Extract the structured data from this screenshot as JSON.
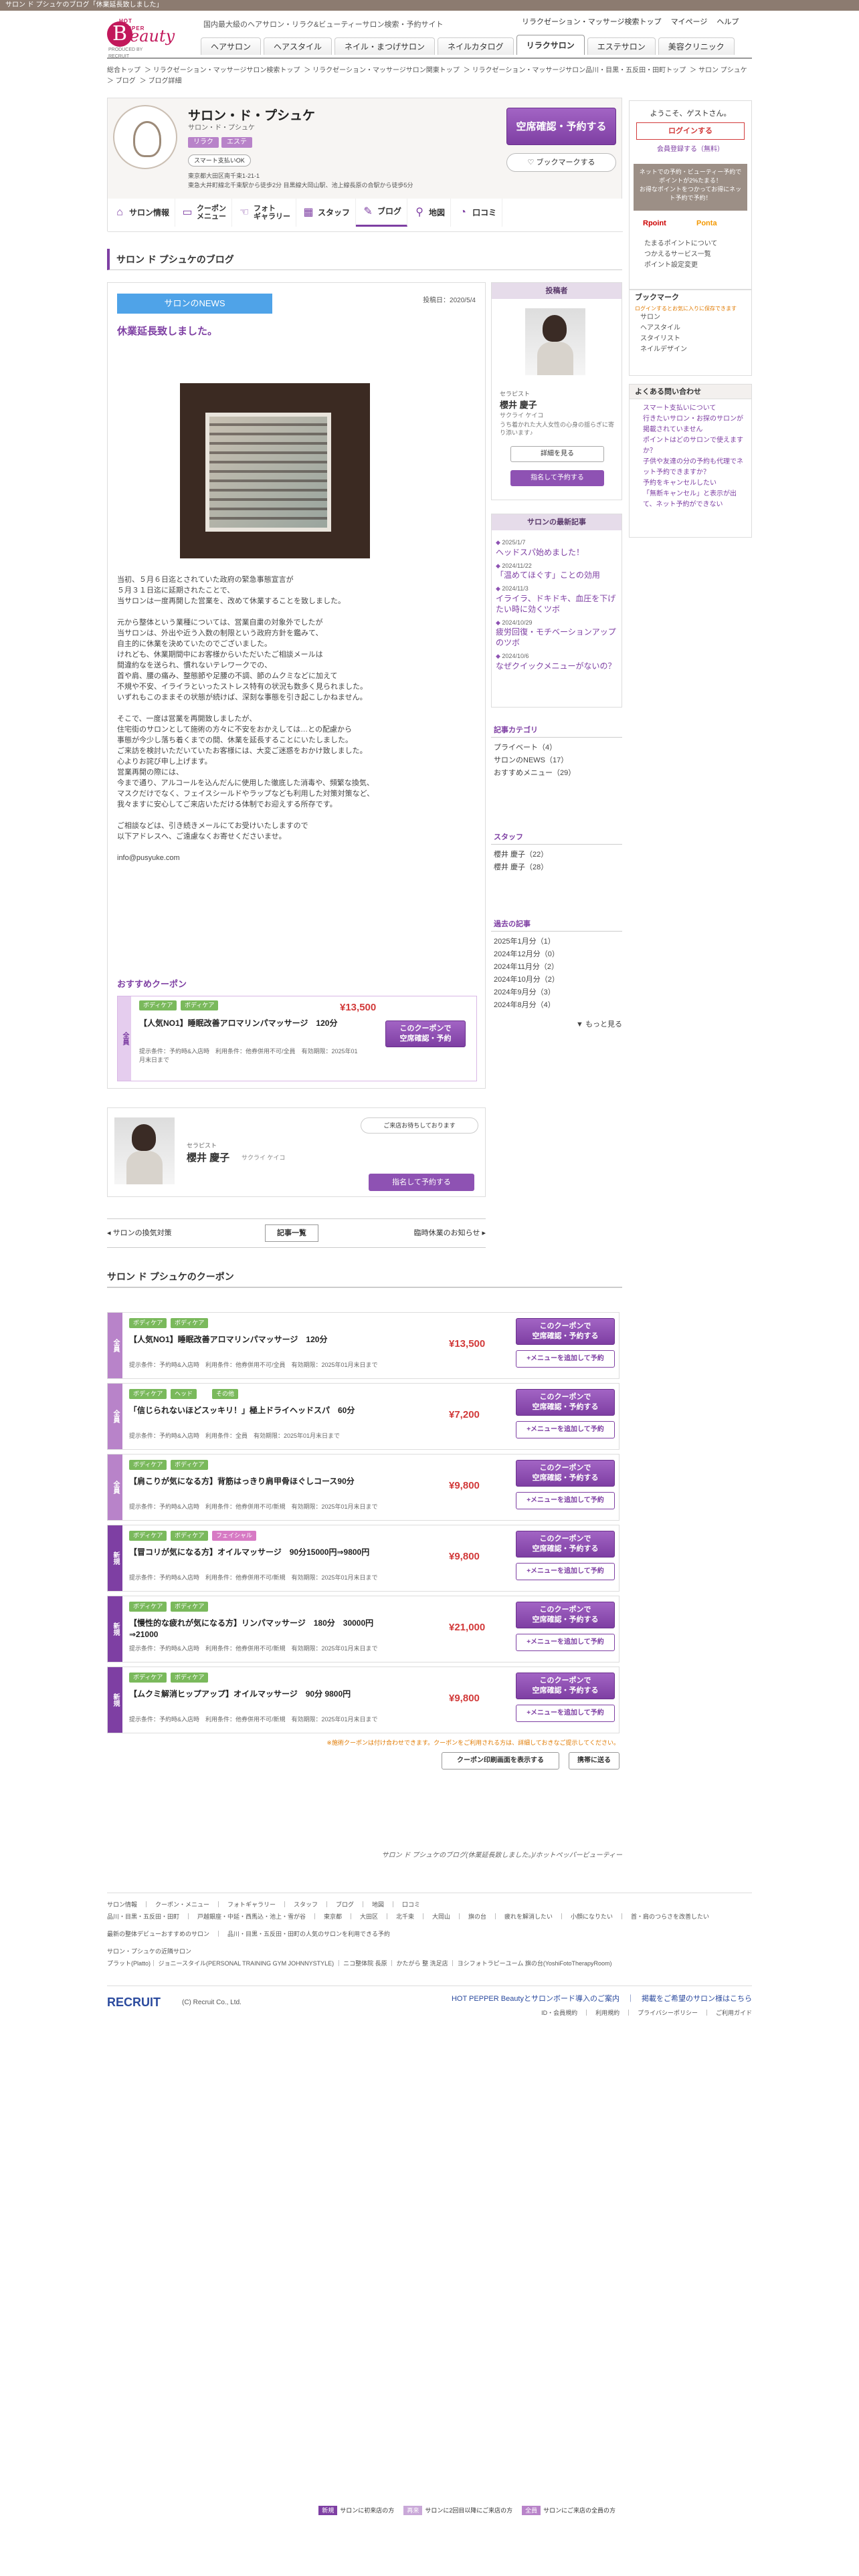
{
  "top_strip": "サロン ド プシュケのブログ「休業延長致しました」",
  "header": {
    "logo_hp": "HOT PEPPER",
    "logo_b": "B",
    "logo_eauty": "eauty",
    "logo_by": "PRODUCED BY RECRUIT",
    "tagline": "国内最大級のヘアサロン・リラク&ビューティーサロン検索・予約サイト",
    "links": [
      "リラクゼーション・マッサージ検索トップ",
      "マイページ",
      "ヘルプ"
    ],
    "nav": [
      "ヘアサロン",
      "ヘアスタイル",
      "ネイル・まつげサロン",
      "ネイルカタログ",
      "リラクサロン",
      "エステサロン",
      "美容クリニック"
    ]
  },
  "breadcrumb": [
    "総合トップ",
    "リラクゼーション・マッサージサロン検索トップ",
    "リラクゼーション・マッサージサロン関東トップ",
    "リラクゼーション・マッサージサロン品川・目黒・五反田・田町トップ",
    "サロン プシュケ",
    "ブログ",
    "ブログ詳細"
  ],
  "shop": {
    "name": "サロン・ド・プシュケ",
    "kana": "サロン・ド・プシュケ",
    "tags": [
      "リラク",
      "エステ"
    ],
    "smartpay": "スマート支払いOK",
    "addr1": "東京都大田区南千束1-21-1",
    "addr2": "東急大井町線北千束駅から徒歩2分 目黒線大岡山駅、池上線長原の合駅から徒歩5分",
    "reserve_btn": "空席確認・予約する",
    "bookmark_btn": "ブックマークする",
    "tabs": [
      "サロン情報",
      "クーポン\nメニュー",
      "フォト\nギャラリー",
      "スタッフ",
      "ブログ",
      "地図",
      "口コミ"
    ]
  },
  "blog": {
    "heading": "サロン ド プシュケのブログ",
    "category": "サロンのNEWS",
    "date": "投稿日：2020/5/4",
    "title": "休業延長致しました。",
    "body": [
      "当初、５月６日迄とされていた政府の緊急事態宣言が",
      "５月３１日迄に延期されたことで、",
      "当サロンは一度再開した営業を、改めて休業することを致しました。",
      "",
      "元から整体という業種については、営業自粛の対象外でしたが",
      "当サロンは、外出や近う入数の制限という政府方針を鑑みて、",
      "自主的に休業を決めていたのでございました。",
      "けれども、休業期間中にお客様からいただいたご相談メールは",
      "間違約なを送られ、慣れないテレワークでの、",
      "首や肩、腰の痛み、整態節や足腰の不調、節のムクミなどに加えて",
      "不規や不安、イライラといったストレス特有の状況も数多く見られました。",
      "いずれもこのままその状態が続けば、深刻な事態を引き起こしかねません。",
      "",
      "そこで、一度は営業を再開致しましたが、",
      "住宅街のサロンとして施術の方々に不安をおかえしては…との配慮から",
      "事態が今少し落ち着くまでの間、休業を延長することにいたしました。",
      "ご来訪を検討いただいていたお客様には、大変ご迷惑をおかけ致しました。",
      "心よりお詫び申し上げます。",
      "営業再開の際には、",
      "今まで通り、アルコールを込んだんに使用した徹底した消毒や、頻繁な換気、",
      "マスクだけでなく、フェイスシールドやラップなども利用した対策対策など、",
      "我々ますに安心してご来店いただける体制でお迎えする所存です。",
      "",
      "ご相談などは、引き続きメールにてお受けいたしますので",
      "以下アドレスへ、ご遠慮なくお寄せくださいませ。",
      "",
      "info@pusyuke.com"
    ],
    "rec_title": "おすすめクーポン",
    "rec_coupon": {
      "band": "全員",
      "tags": [
        "ボディケア",
        "ボディケア"
      ],
      "price": "¥13,500",
      "name": "【人気NO1】睡眠改善アロマリンパマッサージ　120分",
      "meta": "提示条件：予約時&入店時　利用条件：他券併用不可/全員　有効期限：2025年01月末日まで",
      "btn": "このクーポンで\n空席確認・予約"
    }
  },
  "staff_box": {
    "bubble": "ご来店お待ちしております",
    "role": "セラピスト",
    "name": "櫻井 慶子",
    "kana": "サクライ ケイコ",
    "btn": "指名して予約する"
  },
  "pager": {
    "prev": "サロンの換気対策",
    "list": "記事一覧",
    "next": "臨時休業のお知らせ"
  },
  "poster": {
    "head": "投稿者",
    "role": "セラピスト",
    "name": "櫻井 慶子",
    "kana": "サクライ ケイコ",
    "desc": "うち着かれた大人女性の心身の揺らぎに寄り添います♪",
    "detail_btn": "詳細を見る",
    "nominate_btn": "指名して予約する"
  },
  "recent": {
    "head": "サロンの最新記事",
    "items": [
      {
        "date": "2025/1/7",
        "title": "ヘッドスパ始めました！"
      },
      {
        "date": "2024/11/22",
        "title": "「温めてほぐす」ことの効用"
      },
      {
        "date": "2024/11/3",
        "title": "イライラ、ドキドキ、血圧を下げたい時に効くツボ"
      },
      {
        "date": "2024/10/29",
        "title": "疲労回復・モチベーションアップのツボ"
      },
      {
        "date": "2024/10/6",
        "title": "なぜクイックメニューがないの？"
      }
    ]
  },
  "categories": {
    "head": "記事カテゴリ",
    "items": [
      "プライベート（4）",
      "サロンのNEWS（17）",
      "おすすめメニュー（29）"
    ]
  },
  "staff": {
    "head": "スタッフ",
    "items": [
      "櫻井 慶子（22）",
      "櫻井 慶子（28）"
    ]
  },
  "archive": {
    "head": "過去の記事",
    "items": [
      "2025年1月分（1）",
      "2024年12月分（0）",
      "2024年11月分（2）",
      "2024年10月分（2）",
      "2024年9月分（3）",
      "2024年8月分（4）"
    ],
    "more": "もっと見る"
  },
  "coupons": {
    "heading": "サロン ド プシュケのクーポン",
    "legend": [
      {
        "badge": "新規",
        "text": "サロンに初来店の方",
        "color": "#7e3fa3"
      },
      {
        "badge": "再来",
        "text": "サロンに2回目以降にご来店の方",
        "color": "#c9a8d8"
      },
      {
        "badge": "全員",
        "text": "サロンにご来店の全員の方",
        "color": "#b883c9"
      }
    ],
    "items": [
      {
        "band": "全員",
        "tags": [
          "ボディケア",
          "ボディケア"
        ],
        "name": "【人気NO1】睡眠改善アロマリンパマッサージ　120分",
        "meta": "提示条件：予約時&入店時　利用条件：他券併用不可/全員　有効期限：2025年01月末日まで",
        "price": "¥13,500"
      },
      {
        "band": "全員",
        "tags": [
          "ボディケア",
          "ヘッド",
          "その他"
        ],
        "name": "「信じられないほどスッキリ！」極上ドライヘッドスパ　60分",
        "meta": "提示条件：予約時&入店時　利用条件：全員　有効期限：2025年01月末日まで",
        "price": "¥7,200"
      },
      {
        "band": "全員",
        "tags": [
          "ボディケア",
          "ボディケア"
        ],
        "name": "【肩こりが気になる方】背筋はっきり肩甲骨ほぐしコース90分",
        "meta": "提示条件：予約時&入店時　利用条件：他券併用不可/新規　有効期限：2025年01月末日まで",
        "price": "¥9,800"
      },
      {
        "band": "新規",
        "tags": [
          "ボディケア",
          "ボディケア",
          "フェイシャル"
        ],
        "name": "【冒コリが気になる方】オイルマッサージ　90分15000円⇒9800円",
        "meta": "提示条件：予約時&入店時　利用条件：他券併用不可/新規　有効期限：2025年01月末日まで",
        "price": "¥9,800"
      },
      {
        "band": "新規",
        "tags": [
          "ボディケア",
          "ボディケア"
        ],
        "name": "【慢性的な疲れが気になる方】リンパマッサージ　180分　30000円⇒21000",
        "meta": "提示条件：予約時&入店時　利用条件：他券併用不可/新規　有効期限：2025年01月末日まで",
        "price": "¥21,000"
      },
      {
        "band": "新規",
        "tags": [
          "ボディケア",
          "ボディケア"
        ],
        "name": "【ムクミ解消ヒップアップ】オイルマッサージ　90分 9800円",
        "meta": "提示条件：予約時&入店時　利用条件：他券併用不可/新規　有効期限：2025年01月末日まで",
        "price": "¥9,800"
      }
    ],
    "btn": "このクーポンで\n空席確認・予約する",
    "add_btn": "+メニューを追加して予約",
    "note": "※施術クーポンは付け合わせできます。クーポンをご利用される方は、詳細しておきなご提示してください。",
    "print_btn": "クーポン印刷画面を表示する",
    "back_btn": "携帯に送る"
  },
  "bottom_caption": "サロン ド プシュケのブログ(休業延長致しました。)/ホットペッパービューティー",
  "sidebar": {
    "welcome": "ようこそ、ゲストさん。",
    "login": "ログインする",
    "signup": "会員登録する（無料）",
    "promo": "ネットでの予約・ビューティー予約でポイントが2%たまる！",
    "promo2": "お得なポイントをつかってお得にネット予約で予約！",
    "pay1": "Rpoint",
    "pay2": "Ponta",
    "links": [
      "たまるポイントについて",
      "つかえるサービス一覧",
      "ポイント設定変更"
    ],
    "bm_head": "ブックマーク",
    "bm_note": "ログインするとお気に入りに保存できます",
    "bm_items": [
      "サロン",
      "ヘアスタイル",
      "スタイリスト",
      "ネイルデザイン"
    ],
    "faq_head": "よくある問い合わせ",
    "faq": [
      "スマート支払いについて",
      "行きたいサロン・お探のサロンが掲載されていません",
      "ポイントはどのサロンで使えますか？",
      "子供や友達の分の予約も代理でネット予約できますか？",
      "予約をキャンセルしたい",
      "「無断キャンセル」と表示が出て、ネット予約ができない"
    ]
  },
  "footer": {
    "line1": "サロン情報　｜　クーポン・メニュー　｜　フォトギャラリー　｜　スタッフ　｜　ブログ　｜　地図　｜　口コミ",
    "line2": "品川・目黒・五反田・田町　｜　戸越銀座・中延・西馬込・池上・雪が谷　｜　東京都　｜　大田区　｜　北千束　｜　大岡山　｜　旗の台　｜　疲れを解消したい　｜　小顔になりたい　｜　首・肩のつらさを改善したい",
    "line3": "最新の整体デビューおすすめのサロン　｜　品川・目黒・五反田・田町の人気のサロンを利用できる予約",
    "line4": "サロン・プシュケの近隣サロン",
    "line5": "プラット(Platto)｜ ジョニースタイル(PERSONAL TRAINING GYM JOHNNYSTYLE) ｜ ニコ整体院 長原 ｜ かたがら 整 洗足店 ｜ ヨシフォトラピーユーム 旗の台(YoshiFotoTherapyRoom)",
    "recruit": "RECRUIT",
    "copy": "(C) Recruit Co., Ltd.",
    "right1": "HOT PEPPER Beautyとサロンボード導入のご案内　｜　掲載をご希望のサロン様はこちら",
    "right2": "ID・会員規約　｜　利用規約　｜　プライバシーポリシー　｜　ご利用ガイド"
  }
}
